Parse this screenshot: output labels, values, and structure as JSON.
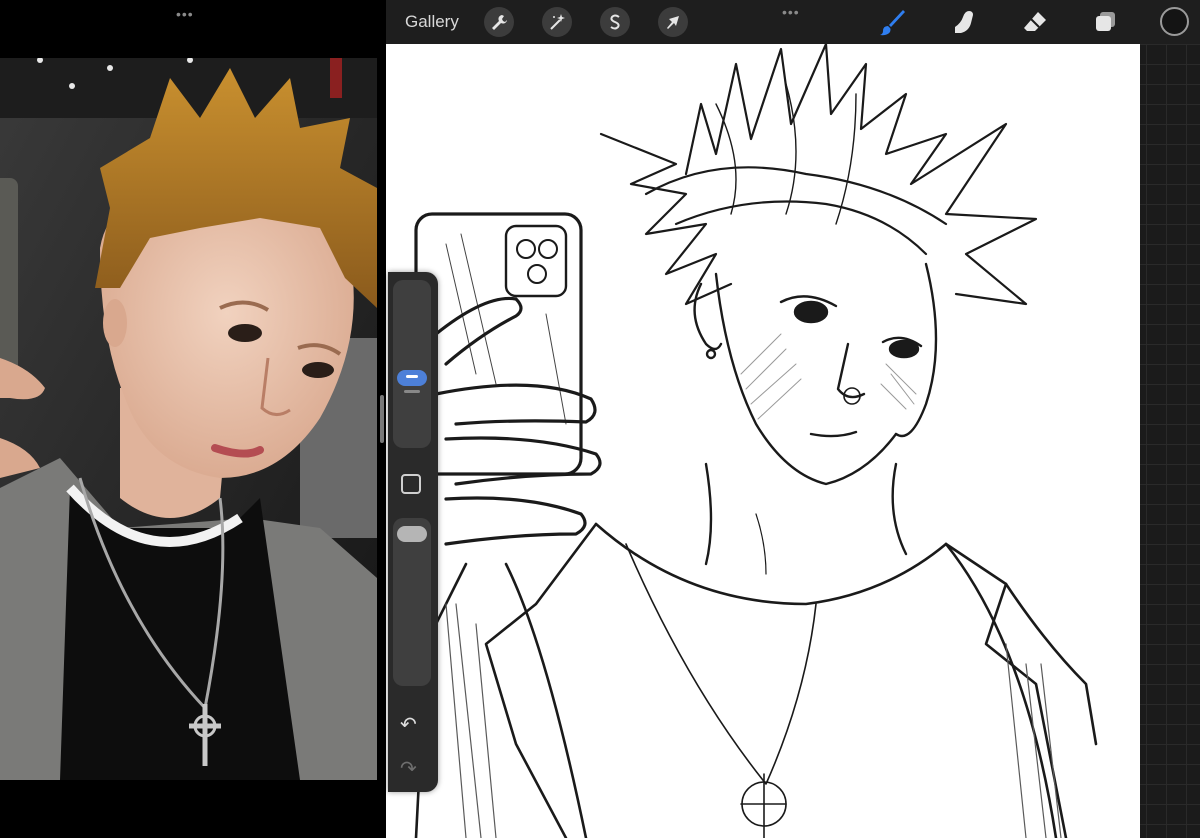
{
  "toolbar": {
    "gallery_label": "Gallery",
    "more_dots": "•••",
    "left_tools": [
      {
        "name": "actions",
        "icon": "wrench-icon"
      },
      {
        "name": "adjustments",
        "icon": "magic-wand-icon"
      },
      {
        "name": "selection",
        "icon": "selection-s-icon"
      },
      {
        "name": "transform",
        "icon": "arrow-cursor-icon"
      }
    ],
    "right_tools": [
      {
        "name": "brush",
        "icon": "brush-icon",
        "active": true
      },
      {
        "name": "smudge",
        "icon": "smudge-finger-icon"
      },
      {
        "name": "eraser",
        "icon": "eraser-icon"
      },
      {
        "name": "layers",
        "icon": "layers-icon"
      }
    ],
    "current_color": "#141414",
    "accent_color": "#2f7ef0"
  },
  "reference": {
    "more_dots": "•••"
  },
  "sidebar": {
    "brush_size_level": 0.4,
    "opacity_level": 1.0,
    "undo_icon": "↶",
    "redo_icon": "↷"
  }
}
